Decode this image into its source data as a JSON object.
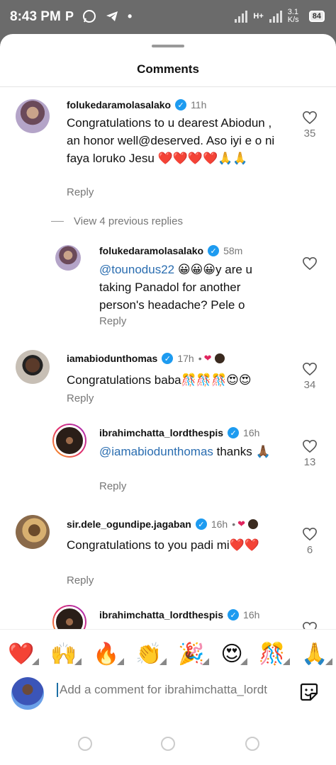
{
  "status_bar": {
    "time": "8:43 PM",
    "icons": [
      "P",
      "whatsapp-icon",
      "telegram-icon",
      "•"
    ],
    "network": "H+",
    "speed": "3.1 K/s",
    "battery": "84"
  },
  "sheet": {
    "title": "Comments"
  },
  "comments": [
    {
      "username": "folukedaramolasalako",
      "verified": true,
      "time": "11h",
      "text": "Congratulations to u dearest Abiodun , an honor well@deserved. Aso iyi e o ni faya loruko Jesu ❤️❤️❤️❤️🙏🙏",
      "reply_label": "Reply",
      "likes": "35"
    },
    {
      "username": "folukedaramolasalako",
      "verified": true,
      "time": "58m",
      "mention": "@tounodus22",
      "text": " 😀😀😀y are u taking Panadol for another person's headache? Pele o",
      "reply_label": "Reply",
      "likes": ""
    },
    {
      "username": "iamabiodunthomas",
      "verified": true,
      "time": "17h",
      "separator": "•",
      "text": "Congratulations baba🎊🎊🎊😍😍",
      "reply_label": "Reply",
      "likes": "34"
    },
    {
      "username": "ibrahimchatta_lordthespis",
      "verified": true,
      "time": "16h",
      "mention": "@iamabiodunthomas",
      "text": " thanks 🙏🏾",
      "reply_label": "Reply",
      "likes": "13"
    },
    {
      "username": "sir.dele_ogundipe.jagaban",
      "verified": true,
      "time": "16h",
      "separator": "•",
      "text": "Congratulations to you padi mi❤️❤️",
      "reply_label": "Reply",
      "likes": "6"
    },
    {
      "username": "ibrahimchatta_lordthespis",
      "verified": true,
      "time": "16h",
      "text": "",
      "reply_label": "",
      "likes": ""
    }
  ],
  "view_replies": "View 4 previous replies",
  "emoji_bar": [
    "❤️",
    "🙌",
    "🔥",
    "👏",
    "🎉",
    "😍",
    "🎊",
    "🙏"
  ],
  "input": {
    "placeholder": "Add a comment for ibrahimchatta_lordt"
  },
  "colors": {
    "mention": "#2a6db0",
    "verified": "#1d9bf0",
    "heart": "#e0245e"
  }
}
